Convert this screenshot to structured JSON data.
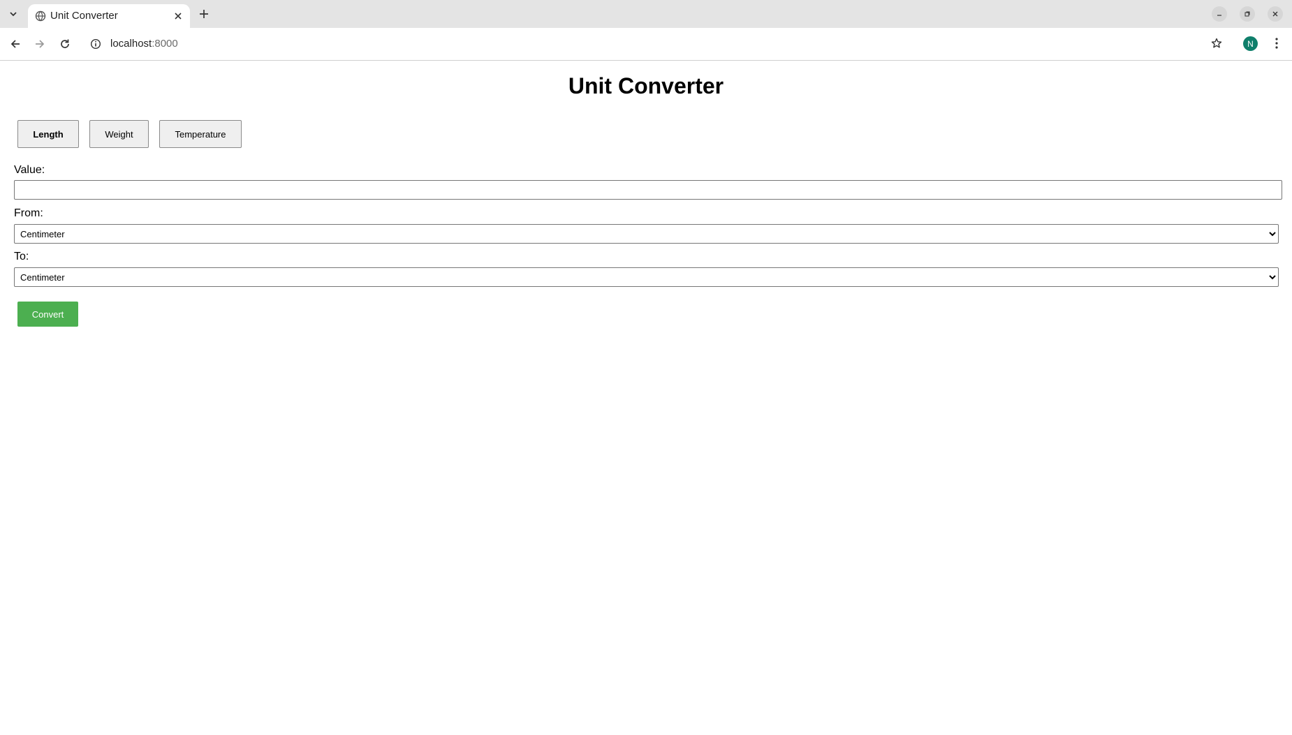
{
  "browser": {
    "tab_title": "Unit Converter",
    "url_host": "localhost",
    "url_port": ":8000",
    "avatar_letter": "N"
  },
  "page": {
    "title": "Unit Converter",
    "categories": [
      {
        "label": "Length",
        "active": true
      },
      {
        "label": "Weight",
        "active": false
      },
      {
        "label": "Temperature",
        "active": false
      }
    ],
    "value_label": "Value:",
    "value_input": "",
    "from_label": "From:",
    "from_selected": "Centimeter",
    "to_label": "To:",
    "to_selected": "Centimeter",
    "convert_label": "Convert"
  },
  "colors": {
    "convert_button": "#4caf50",
    "avatar": "#0f7f6b"
  }
}
